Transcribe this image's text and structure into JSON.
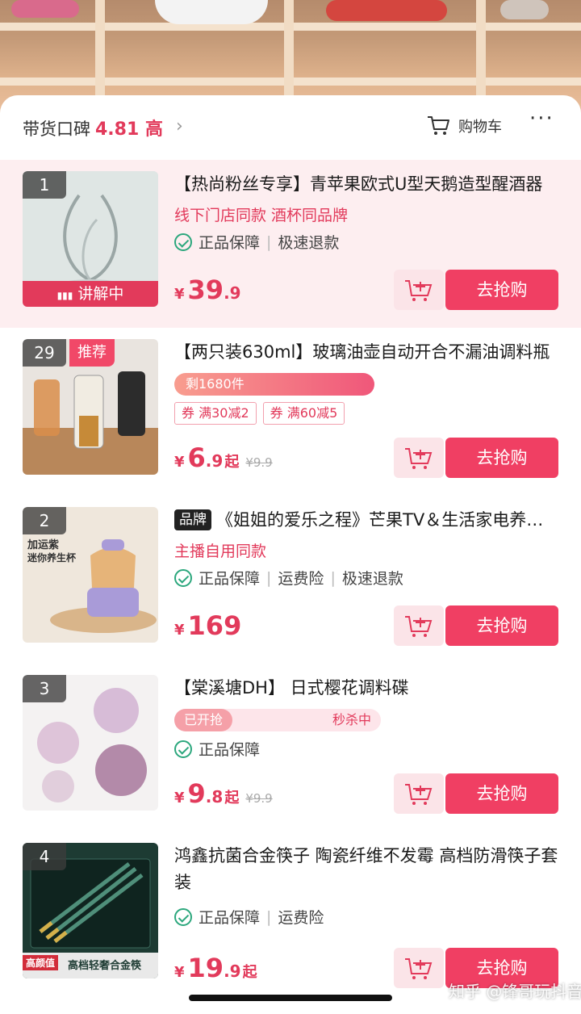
{
  "header": {
    "score_label": "带货口碑",
    "score_value": "4.81 高",
    "cart_label": "购物车"
  },
  "items": [
    {
      "rank": "1",
      "thumb_badge": "讲解中",
      "title": "【热尚粉丝专享】青苹果欧式U型天鹅造型醒酒器",
      "subline": "线下门店同款 酒杯同品牌",
      "guarantees": [
        "正品保障",
        "极速退款"
      ],
      "price_yen": "¥",
      "price_int": "39",
      "price_dec": ".9",
      "buy_label": "去抢购"
    },
    {
      "rank": "29",
      "rec_tag": "推荐",
      "title": "【两只装630ml】玻璃油壶自动开合不漏油调料瓶",
      "stock": "剩1680件",
      "coupons": [
        "券 满30减2",
        "券 满60减5"
      ],
      "price_yen": "¥",
      "price_int": "6",
      "price_dec": ".9",
      "price_suffix": "起",
      "orig_price": "¥9.9",
      "buy_label": "去抢购"
    },
    {
      "rank": "2",
      "brand_tag": "品牌",
      "title": "《姐姐的爱乐之程》芒果TV＆生活家电养生壶",
      "subline": "主播自用同款",
      "guarantees": [
        "正品保障",
        "运费险",
        "极速退款"
      ],
      "thumb_text_1": "加运紫",
      "thumb_text_2": "迷你养生杯",
      "price_yen": "¥",
      "price_int": "169",
      "price_dec": "",
      "buy_label": "去抢购"
    },
    {
      "rank": "3",
      "title": "【棠溪塘DH】 日式樱花调料碟",
      "seckill_started": "已开抢",
      "seckill_status": "秒杀中",
      "guarantees": [
        "正品保障"
      ],
      "price_yen": "¥",
      "price_int": "9",
      "price_dec": ".8",
      "price_suffix": "起",
      "orig_price": "¥9.9",
      "buy_label": "去抢购"
    },
    {
      "rank": "4",
      "title": "鸿鑫抗菌合金筷子 陶瓷纤维不发霉 高档防滑筷子套装",
      "guarantees": [
        "正品保障",
        "运费险"
      ],
      "thumb_text_1": "高颜值",
      "thumb_text_2": "高档轻奢合金筷",
      "price_yen": "¥",
      "price_int": "19",
      "price_dec": ".9",
      "price_suffix": "起",
      "buy_label": "去抢购"
    }
  ],
  "watermark": "知乎 @锋哥玩抖音",
  "colors": {
    "accent": "#f03f63",
    "price": "#e23a5b",
    "check": "#2ca77d",
    "active_row": "#fdeef0"
  }
}
